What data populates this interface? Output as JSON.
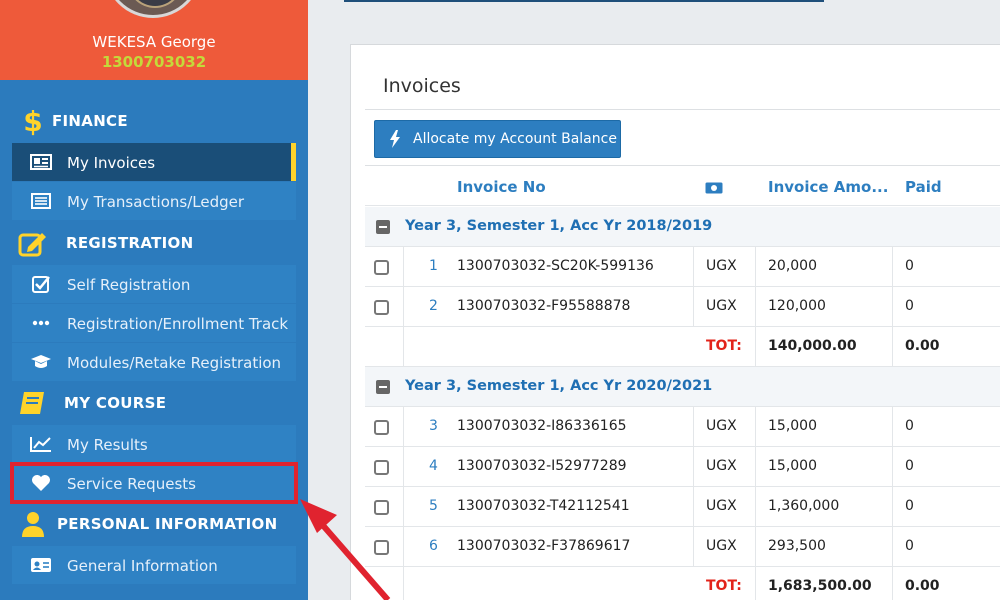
{
  "profile": {
    "name": "WEKESA George",
    "id": "1300703032"
  },
  "sidebar": {
    "finance": {
      "label": "FINANCE",
      "items": [
        {
          "label": "My Invoices"
        },
        {
          "label": "My Transactions/Ledger"
        }
      ]
    },
    "registration": {
      "label": "REGISTRATION",
      "items": [
        {
          "label": "Self Registration"
        },
        {
          "label": "Registration/Enrollment Track"
        },
        {
          "label": "Modules/Retake Registration"
        }
      ]
    },
    "course": {
      "label": "MY COURSE",
      "items": [
        {
          "label": "My Results"
        },
        {
          "label": "Service Requests"
        }
      ]
    },
    "personal": {
      "label": "PERSONAL INFORMATION",
      "items": [
        {
          "label": "General Information"
        }
      ]
    }
  },
  "main": {
    "title": "Invoices",
    "allocate_label": "Allocate my Account Balance",
    "columns": {
      "invoice_no": "Invoice No",
      "amount": "Invoice Amo...",
      "paid": "Paid"
    },
    "groups": [
      {
        "label": "Year 3, Semester 1, Acc Yr 2018/2019",
        "rows": [
          {
            "n": "1",
            "invoice": "1300703032-SC20K-599136",
            "cur": "UGX",
            "amount": "20,000",
            "paid": "0"
          },
          {
            "n": "2",
            "invoice": "1300703032-F95588878",
            "cur": "UGX",
            "amount": "120,000",
            "paid": "0"
          }
        ],
        "total": {
          "label": "TOT:",
          "amount": "140,000.00",
          "paid": "0.00"
        }
      },
      {
        "label": "Year 3, Semester 1, Acc Yr 2020/2021",
        "rows": [
          {
            "n": "3",
            "invoice": "1300703032-I86336165",
            "cur": "UGX",
            "amount": "15,000",
            "paid": "0"
          },
          {
            "n": "4",
            "invoice": "1300703032-I52977289",
            "cur": "UGX",
            "amount": "15,000",
            "paid": "0"
          },
          {
            "n": "5",
            "invoice": "1300703032-T42112541",
            "cur": "UGX",
            "amount": "1,360,000",
            "paid": "0"
          },
          {
            "n": "6",
            "invoice": "1300703032-F37869617",
            "cur": "UGX",
            "amount": "293,500",
            "paid": "0"
          }
        ],
        "total": {
          "label": "TOT:",
          "amount": "1,683,500.00",
          "paid": "0.00"
        }
      }
    ]
  },
  "colors": {
    "sidebar": "#2c7bbd",
    "profile": "#ee5a3a",
    "active_item": "#1a4e78",
    "accent": "#ffd32a",
    "highlight": "#e0232f",
    "link": "#2d7ec0"
  }
}
